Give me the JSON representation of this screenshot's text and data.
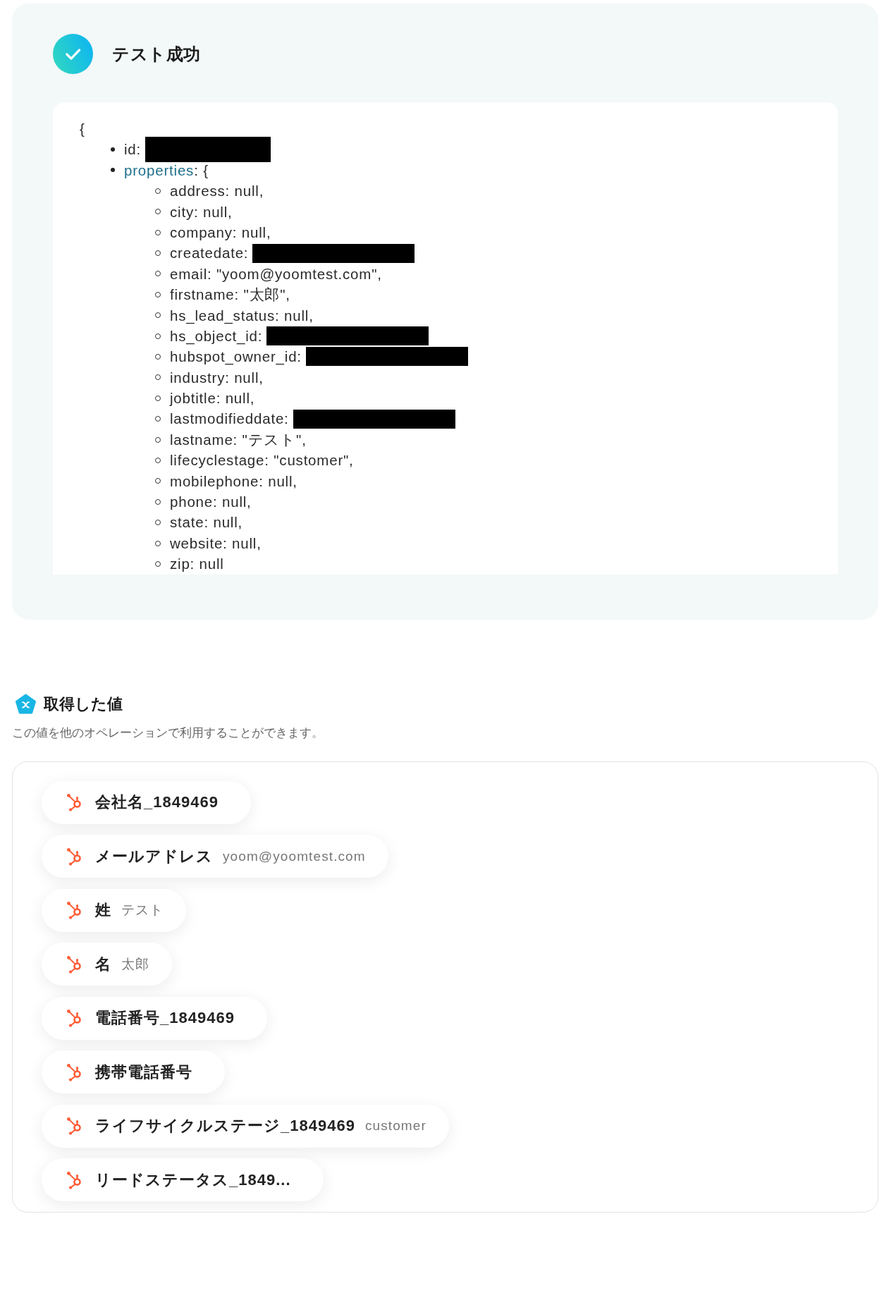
{
  "result_panel": {
    "title": "テスト成功",
    "output": {
      "open": "{",
      "fields": [
        {
          "text": "id:",
          "redacted": true
        },
        {
          "key": "properties",
          "text": ": {",
          "children": [
            {
              "text": "address: null,"
            },
            {
              "text": "city: null,"
            },
            {
              "text": "company: null,"
            },
            {
              "text": "createdate:",
              "redacted": true
            },
            {
              "text": "email: \"yoom@yoomtest.com\","
            },
            {
              "text": "firstname: \"太郎\","
            },
            {
              "text": "hs_lead_status: null,"
            },
            {
              "text": "hs_object_id:",
              "redacted": true
            },
            {
              "text": "hubspot_owner_id:",
              "redacted": true
            },
            {
              "text": "industry: null,"
            },
            {
              "text": "jobtitle: null,"
            },
            {
              "text": "lastmodifieddate:",
              "redacted": true
            },
            {
              "text": "lastname: \"テスト\","
            },
            {
              "text": "lifecyclestage: \"customer\","
            },
            {
              "text": "mobilephone: null,"
            },
            {
              "text": "phone: null,"
            },
            {
              "text": "state: null,"
            },
            {
              "text": "website: null,"
            },
            {
              "text": "zip: null"
            }
          ]
        }
      ]
    }
  },
  "outputs_section": {
    "title": "取得した値",
    "description": "この値を他のオペレーションで利用することができます。",
    "values": [
      {
        "label": "会社名_1849469"
      },
      {
        "label": "メールアドレス",
        "value": "yoom@yoomtest.com"
      },
      {
        "label": "姓",
        "value": "テスト"
      },
      {
        "label": "名",
        "value": "太郎"
      },
      {
        "label": "電話番号_1849469"
      },
      {
        "label": "携帯電話番号"
      },
      {
        "label": "ライフサイクルステージ_1849469",
        "value": "customer"
      },
      {
        "label": "リードステータス_1849..."
      }
    ]
  }
}
